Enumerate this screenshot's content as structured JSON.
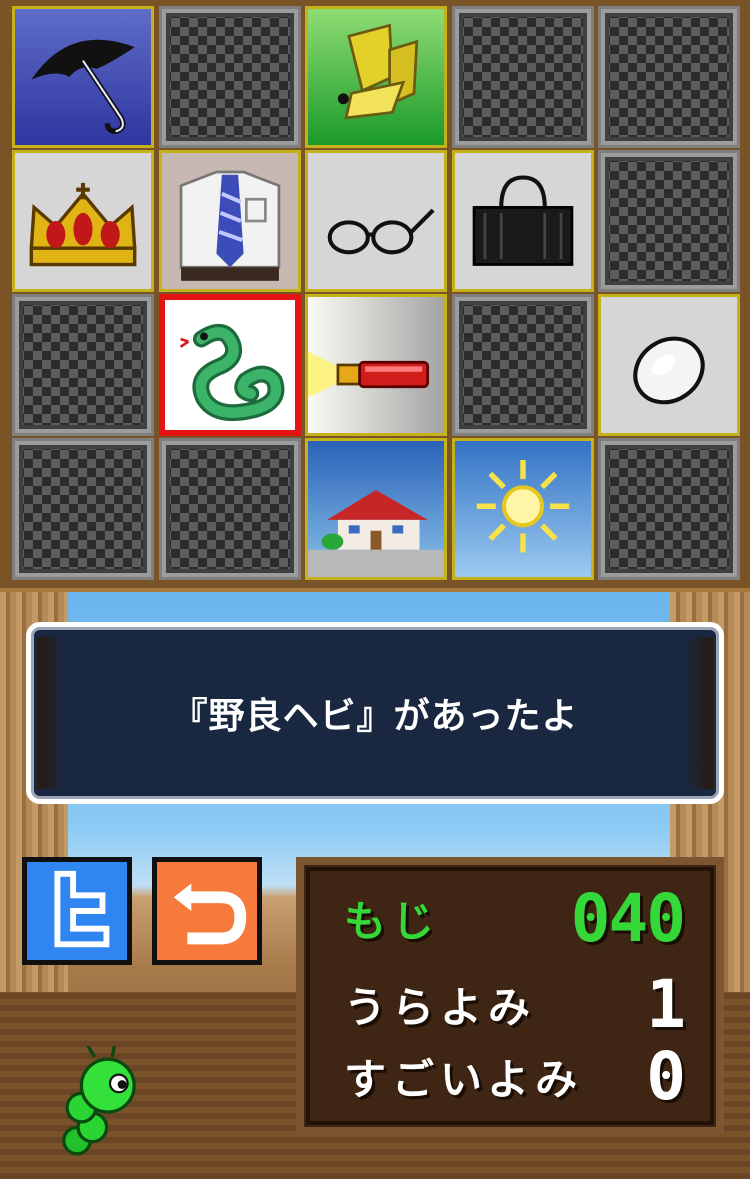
{
  "grid": {
    "items": [
      {
        "name": "umbrella",
        "state": "unlocked",
        "icon": "umbrella-icon"
      },
      {
        "name": "locked",
        "state": "locked",
        "icon": "locked-tile-icon"
      },
      {
        "name": "moth",
        "state": "unlocked",
        "icon": "moth-icon"
      },
      {
        "name": "locked",
        "state": "locked",
        "icon": "locked-tile-icon"
      },
      {
        "name": "locked",
        "state": "locked",
        "icon": "locked-tile-icon"
      },
      {
        "name": "crown",
        "state": "unlocked",
        "icon": "crown-icon"
      },
      {
        "name": "shirt-with-tie",
        "state": "unlocked",
        "icon": "shirt-tie-icon"
      },
      {
        "name": "glasses",
        "state": "unlocked",
        "icon": "glasses-icon"
      },
      {
        "name": "bag",
        "state": "unlocked",
        "icon": "bag-icon"
      },
      {
        "name": "locked",
        "state": "locked",
        "icon": "locked-tile-icon"
      },
      {
        "name": "locked",
        "state": "locked",
        "icon": "locked-tile-icon"
      },
      {
        "name": "stray-snake",
        "state": "selected",
        "icon": "snake-icon"
      },
      {
        "name": "flashlight",
        "state": "unlocked",
        "icon": "flashlight-icon"
      },
      {
        "name": "locked",
        "state": "locked",
        "icon": "locked-tile-icon"
      },
      {
        "name": "egg",
        "state": "unlocked",
        "icon": "egg-icon"
      },
      {
        "name": "locked",
        "state": "locked",
        "icon": "locked-tile-icon"
      },
      {
        "name": "locked",
        "state": "locked",
        "icon": "locked-tile-icon"
      },
      {
        "name": "house",
        "state": "unlocked",
        "icon": "house-icon"
      },
      {
        "name": "sun",
        "state": "unlocked",
        "icon": "sun-icon"
      },
      {
        "name": "locked",
        "state": "locked",
        "icon": "locked-tile-icon"
      }
    ]
  },
  "message": {
    "text": "『野良ヘビ』があったよ"
  },
  "buttons": {
    "twitter_icon": "twitter-t-icon",
    "back_icon": "return-arrow-icon"
  },
  "stats": {
    "moji_label": "もじ",
    "moji_value": "040",
    "urayomi_label": "うらよみ",
    "urayomi_value": "1",
    "sugoiyomi_label": "すごいよみ",
    "sugoiyomi_value": "0"
  },
  "colors": {
    "accent_green": "#34d838",
    "selected_border": "#e21414",
    "tile_border": "#c4b21a",
    "message_bg": "#192840"
  },
  "mascot": {
    "icon": "green-caterpillar-icon"
  }
}
